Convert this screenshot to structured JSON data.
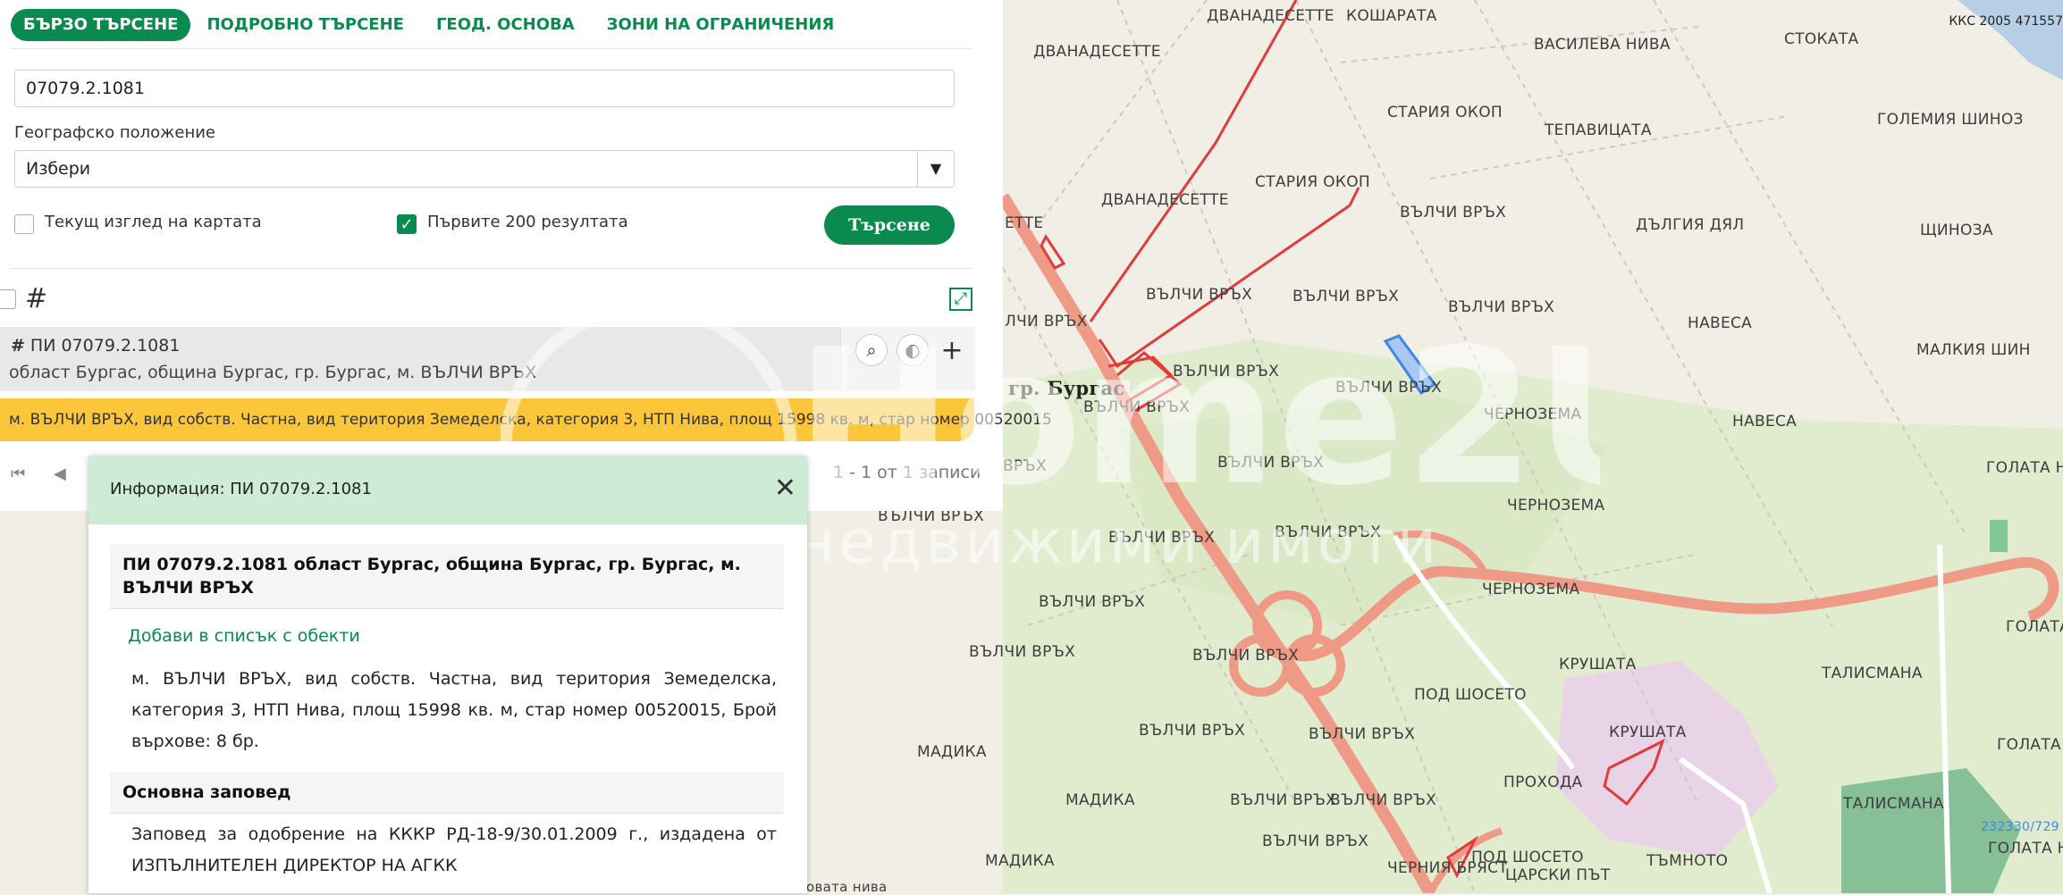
{
  "tabs": [
    "БЪРЗО ТЪРСЕНЕ",
    "ПОДРОБНО ТЪРСЕНЕ",
    "ГЕОД. ОСНОВА",
    "ЗОНИ НА ОГРАНИЧЕНИЯ"
  ],
  "search": {
    "value": "07079.2.1081"
  },
  "geo": {
    "label": "Географско положение",
    "selected": "Избери"
  },
  "checkboxes": {
    "current_view": "Текущ изглед на картата",
    "first_200": "Първите 200 резултата"
  },
  "search_button": "Търсене",
  "result": {
    "title": "ПИ 07079.2.1081",
    "subtitle": "област Бургас, община Бургас, гр. Бургас, м. ВЪЛЧИ ВРЪХ",
    "details": "м. ВЪЛЧИ ВРЪХ, вид собств. Частна, вид територия Земеделска, категория 3, НТП Нива, площ 15998 кв. м, стар номер 00520015"
  },
  "pager": {
    "info": "1 - 1 от 1 записи"
  },
  "info_popup": {
    "header": "Информация: ПИ 07079.2.1081",
    "title": "ПИ 07079.2.1081 област Бургас, община Бургас, гр. Бургас, м. ВЪЛЧИ ВРЪХ",
    "add_link": "Добави в списък с обекти",
    "description": "м. ВЪЛЧИ ВРЪХ, вид собств. Частна, вид територия Земеделска, категория 3, НТП Нива, площ 15998 кв. м, стар номер 00520015, Брой върхове: 8 бр.",
    "order_title": "Основна заповед",
    "order_text": "Заповед за одобрение на КККР РД-18-9/30.01.2009 г., издадена от ИЗПЪЛНИТЕЛЕН ДИРЕКТОР НА АГКК"
  },
  "map": {
    "kks": "ККС 2005 471557",
    "city": "гр. Бургас",
    "labels": [
      "ДВАНАДЕСЕТТЕ",
      "КОШАРАТА",
      "ДВАНАДЕСЕТТЕ",
      "ВАСИЛЕВА НИВА",
      "СТОКАТА",
      "СТАРИЯ ОКОП",
      "ТЕПАВИЦАТА",
      "ГОЛЕМИЯ ШИНОЗ",
      "СТАРИЯ ОКОП",
      "ДВАНАДЕСЕТТЕ",
      "ВЪЛЧИ ВРЪХ",
      "ДЪЛГИЯ ДЯЛ",
      "ЩИНОЗА",
      "ЕТТЕ",
      "ВЪЛЧИ ВРЪХ",
      "ВЪЛЧИ ВРЪХ",
      "ВЪЛЧИ ВРЪХ",
      "НАВЕСА",
      "ЛЧИ ВРЪХ",
      "МАЛКИЯ ШИН",
      "ВЪЛЧИ ВРЪХ",
      "ВЪЛЧИ ВРЪХ",
      "ВЪЛЧИ ВРЪХ",
      "ЧЕРНОЗЕМА",
      "НАВЕСА",
      "ВЪЛЧИ ВРЪХ",
      "ГОЛАТА Н",
      "ВРЪХ",
      "ЧЕРНОЗЕМА",
      "ВЪЛЧИ ВРЪХ",
      "ВЪЛЧИ ВРЪХ",
      "ВЪЛЧИ ВРЪХ",
      "ЧЕРНОЗЕМА",
      "ВЪЛЧИ ВРЪХ",
      "ГОЛАТА",
      "ВЪЛЧИ ВРЪХ",
      "ВЪЛЧИ ВРЪХ",
      "КРУШАТА",
      "ТАЛИСМАНА",
      "ПОД ШОСЕТО",
      "КРУШАТА",
      "МАДИКА",
      "ВЪЛЧИ ВРЪХ",
      "ВЪЛЧИ ВРЪХ",
      "ГОЛАТА",
      "ПРОХОДА",
      "МАДИКА",
      "ВЪЛЧИ ВРЪХ",
      "ВЪЛЧИ ВРЪХ",
      "ТАЛИСМАНА",
      "ВЪЛЧИ ВРЪХ",
      "МАДИКА",
      "ПОД ШОСЕТО",
      "ЦАРСКИ ПЪТ",
      "ТЪМНОТО",
      "ГОЛАТА Н",
      "ЧЕРНИЯ БРЯСТ",
      "овата нива"
    ],
    "coord": "232330/729"
  },
  "watermark": {
    "brand": "Home2U",
    "tagline": "недвижими имоти"
  }
}
